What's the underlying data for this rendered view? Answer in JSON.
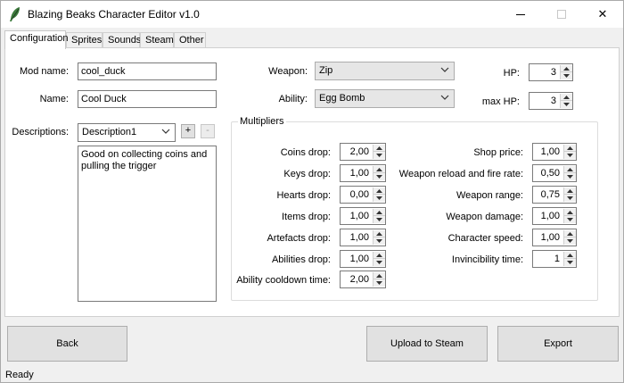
{
  "window": {
    "title": "Blazing Beaks Character Editor v1.0",
    "controls": {
      "minimize": "—",
      "maximize": "☐",
      "close": "✕"
    }
  },
  "tabs": [
    "Configuration",
    "Sprites",
    "Sounds",
    "Steam",
    "Other"
  ],
  "config": {
    "mod_name": {
      "label": "Mod name:",
      "value": "cool_duck"
    },
    "name": {
      "label": "Name:",
      "value": "Cool Duck"
    },
    "descriptions": {
      "label": "Descriptions:",
      "selected": "Description1",
      "add": "+",
      "remove": "-"
    },
    "description_text": "Good on collecting coins and pulling the trigger",
    "weapon": {
      "label": "Weapon:",
      "selected": "Zip"
    },
    "ability": {
      "label": "Ability:",
      "selected": "Egg Bomb"
    },
    "hp": {
      "label": "HP:",
      "value": "3"
    },
    "max_hp": {
      "label": "max HP:",
      "value": "3"
    }
  },
  "multipliers": {
    "title": "Multipliers",
    "left": [
      {
        "label": "Coins drop:",
        "value": "2,00"
      },
      {
        "label": "Keys drop:",
        "value": "1,00"
      },
      {
        "label": "Hearts drop:",
        "value": "0,00"
      },
      {
        "label": "Items drop:",
        "value": "1,00"
      },
      {
        "label": "Artefacts drop:",
        "value": "1,00"
      },
      {
        "label": "Abilities drop:",
        "value": "1,00"
      },
      {
        "label": "Ability cooldown time:",
        "value": "2,00"
      }
    ],
    "right": [
      {
        "label": "Shop price:",
        "value": "1,00"
      },
      {
        "label": "Weapon reload and fire rate:",
        "value": "0,50"
      },
      {
        "label": "Weapon range:",
        "value": "0,75"
      },
      {
        "label": "Weapon damage:",
        "value": "1,00"
      },
      {
        "label": "Character speed:",
        "value": "1,00"
      },
      {
        "label": "Invincibility time:",
        "value": "1"
      }
    ]
  },
  "buttons": {
    "back": "Back",
    "upload": "Upload to Steam",
    "export": "Export"
  },
  "status": "Ready",
  "icons": {
    "app": "feather-icon",
    "combo": "chevron-down-icon",
    "spin": "spin-arrows-icon"
  },
  "colors": {
    "titlebar": "#ffffff",
    "window": "#f0f0f0",
    "panel": "#ffffff",
    "button": "#e1e1e1"
  }
}
